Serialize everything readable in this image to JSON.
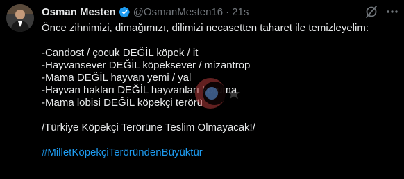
{
  "author": {
    "name": "Osman Mesten",
    "handle": "@OsmanMesten16",
    "separator": "·",
    "time": "21s"
  },
  "icons": {
    "avatar": "avatar-photo",
    "verified": "verified-badge-icon",
    "grok": "grok-icon",
    "more": "more-options-icon",
    "watermark": "crescent-star-watermark"
  },
  "colors": {
    "background": "#000000",
    "text": "#e7e9ea",
    "muted": "#71767b",
    "link": "#1d9bf0",
    "verified": "#1d9bf0"
  },
  "tweet": {
    "lines": [
      "Önce zihnimizi, dimağımızı, dilimizi necasetten taharet ile temizleyelim:",
      "",
      "-Candost / çocuk DEĞİL köpek / it",
      "-Hayvansever DEĞİL köpeksever / mizantrop",
      "-Mama DEĞİL hayvan yemi / yal",
      "-Hayvan hakları DEĞİL hayvanları koruma",
      "-Mama lobisi DEĞİL köpekçi terörü",
      "",
      "/Türkiye Köpekçi Terörüne Teslim Olmayacak!/",
      ""
    ],
    "hashtag": "#MilletKöpekçiTeröründenBüyüktür"
  }
}
